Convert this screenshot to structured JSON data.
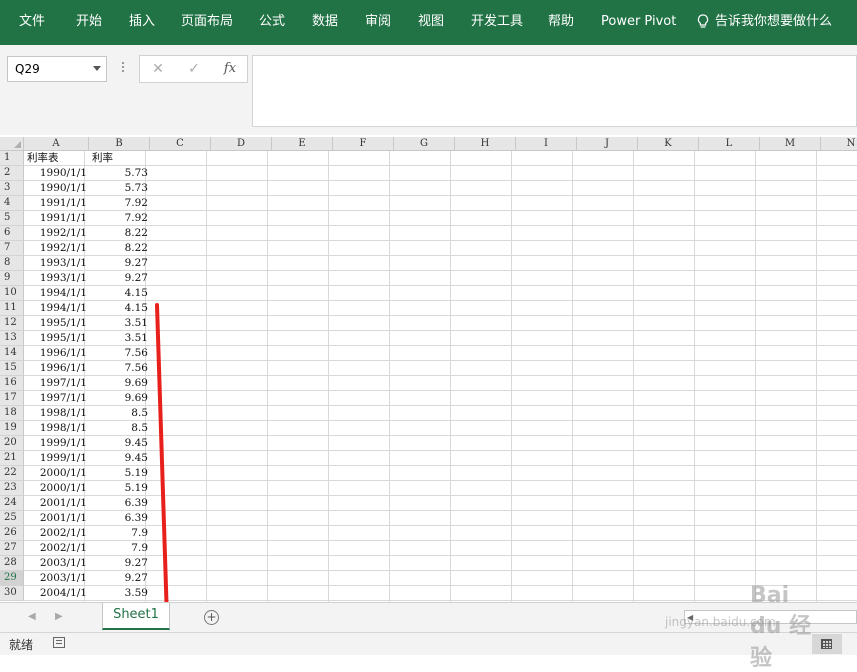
{
  "ribbon": {
    "tabs": [
      "文件",
      "开始",
      "插入",
      "页面布局",
      "公式",
      "数据",
      "审阅",
      "视图",
      "开发工具",
      "帮助",
      "Power Pivot"
    ],
    "tell_me": "告诉我你想要做什么"
  },
  "formula_bar": {
    "name_box": "Q29",
    "cancel_icon": "✕",
    "enter_icon": "✓",
    "fx_label": "fx",
    "formula": ""
  },
  "sheet": {
    "columns": [
      "A",
      "B",
      "C",
      "D",
      "E",
      "F",
      "G",
      "H",
      "I",
      "J",
      "K",
      "L",
      "M",
      "N"
    ],
    "row_numbers": [
      "1",
      "2",
      "3",
      "4",
      "5",
      "6",
      "7",
      "8",
      "9",
      "10",
      "11",
      "12",
      "13",
      "14",
      "15",
      "16",
      "17",
      "18",
      "19",
      "20",
      "21",
      "22",
      "23",
      "24",
      "25",
      "26",
      "27",
      "28",
      "29",
      "30"
    ],
    "selected_row": "29",
    "header_row": {
      "a": "利率表",
      "b": "利率"
    },
    "rows": [
      {
        "a": "1990/1/1",
        "b": "5.73"
      },
      {
        "a": "1990/1/1",
        "b": "5.73"
      },
      {
        "a": "1991/1/1",
        "b": "7.92"
      },
      {
        "a": "1991/1/1",
        "b": "7.92"
      },
      {
        "a": "1992/1/1",
        "b": "8.22"
      },
      {
        "a": "1992/1/1",
        "b": "8.22"
      },
      {
        "a": "1993/1/1",
        "b": "9.27"
      },
      {
        "a": "1993/1/1",
        "b": "9.27"
      },
      {
        "a": "1994/1/1",
        "b": "4.15"
      },
      {
        "a": "1994/1/1",
        "b": "4.15"
      },
      {
        "a": "1995/1/1",
        "b": "3.51"
      },
      {
        "a": "1995/1/1",
        "b": "3.51"
      },
      {
        "a": "1996/1/1",
        "b": "7.56"
      },
      {
        "a": "1996/1/1",
        "b": "7.56"
      },
      {
        "a": "1997/1/1",
        "b": "9.69"
      },
      {
        "a": "1997/1/1",
        "b": "9.69"
      },
      {
        "a": "1998/1/1",
        "b": "8.5"
      },
      {
        "a": "1998/1/1",
        "b": "8.5"
      },
      {
        "a": "1999/1/1",
        "b": "9.45"
      },
      {
        "a": "1999/1/1",
        "b": "9.45"
      },
      {
        "a": "2000/1/1",
        "b": "5.19"
      },
      {
        "a": "2000/1/1",
        "b": "5.19"
      },
      {
        "a": "2001/1/1",
        "b": "6.39"
      },
      {
        "a": "2001/1/1",
        "b": "6.39"
      },
      {
        "a": "2002/1/1",
        "b": "7.9"
      },
      {
        "a": "2002/1/1",
        "b": "7.9"
      },
      {
        "a": "2003/1/1",
        "b": "9.27"
      },
      {
        "a": "2003/1/1",
        "b": "9.27"
      },
      {
        "a": "2004/1/1",
        "b": "3.59"
      }
    ],
    "annotation_color": "#e8201c"
  },
  "sheet_tabs": {
    "active": "Sheet1",
    "prev_icon": "◀",
    "next_icon": "▶",
    "add_icon": "+"
  },
  "status_bar": {
    "ready": "就绪"
  },
  "watermark": {
    "brand": "Bai du 经验",
    "url": "jingyan.baidu.com"
  },
  "colors": {
    "accent": "#217346",
    "ribbon_text": "#ffffff"
  }
}
